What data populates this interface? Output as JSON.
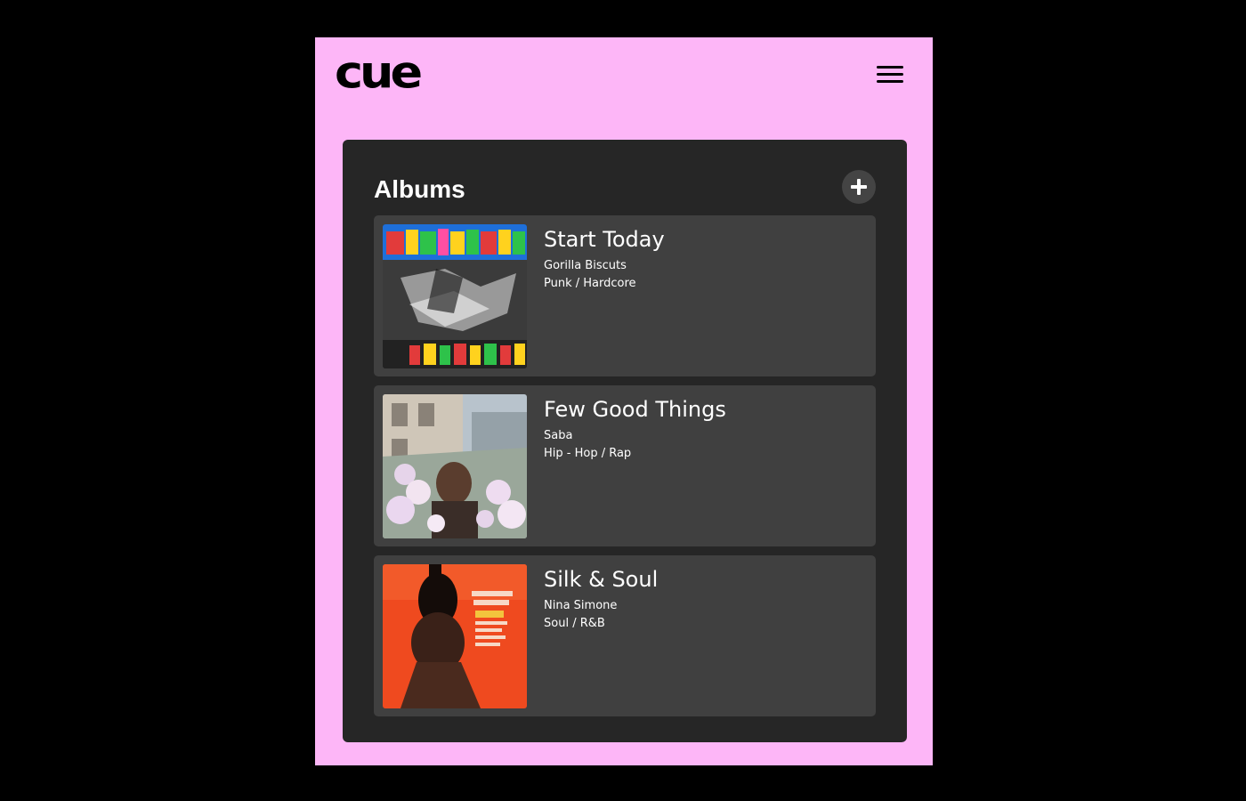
{
  "app": {
    "logo_text": "cue",
    "menu_icon": "hamburger-menu-icon",
    "background_color": "#fdb6f7"
  },
  "albums": {
    "title": "Albums",
    "add_icon": "plus-icon",
    "items": [
      {
        "title": "Start Today",
        "artist": "Gorilla Biscuts",
        "genre": "Punk / Hardcore"
      },
      {
        "title": "Few Good Things",
        "artist": "Saba",
        "genre": "Hip - Hop / Rap"
      },
      {
        "title": "Silk & Soul",
        "artist": "Nina Simone",
        "genre": "Soul / R&B"
      }
    ]
  }
}
